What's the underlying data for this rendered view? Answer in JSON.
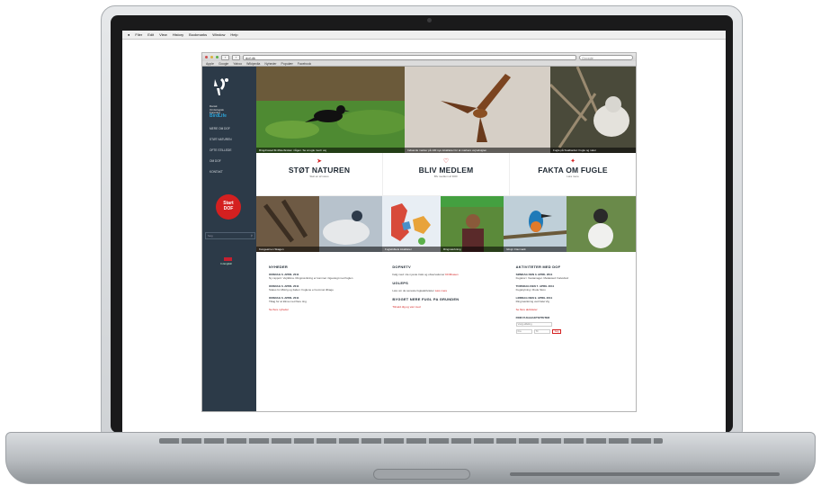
{
  "os_menu": [
    "Filer",
    "Edit",
    "View",
    "History",
    "Bookmarks",
    "Window",
    "Help"
  ],
  "browser": {
    "back": "‹",
    "forward": "›",
    "url": "dof.dk",
    "search_placeholder": "Google",
    "bookmarks": [
      "Apple",
      "Google",
      "Yahoo",
      "Wikipedia",
      "Nyheder",
      "Populær",
      "Facebook"
    ]
  },
  "sidebar": {
    "org_line1": "Dansk",
    "org_line2": "Ornitologisk",
    "org_line3": "Forening",
    "org_brand": "BirdLife",
    "nav": [
      "Mere om DOF",
      "Støt naturen",
      "Ofte stillede",
      "Om DOF",
      "Kontakt"
    ],
    "start_line1": "Start",
    "start_line2": "DOF",
    "search_placeholder": "Søg",
    "search_icon": "magnifier-icon",
    "lang_label": "In English"
  },
  "hero_captions": [
    "Ringdrossel fik Østerbrokan i tågen. Se at ugle med i vej",
    "Indsamle marker på 130 nye lokaliteter for at markere vejrudsigten",
    "Fugle på Svalbardet: Fugle og natur"
  ],
  "ctas": [
    {
      "icon": "bird-icon",
      "title": "STØT NATUREN",
      "sub": "Støt en af vores"
    },
    {
      "icon": "heart-icon",
      "title": "BLIV MEDLEM",
      "sub": "Blv medlem af DOF"
    },
    {
      "icon": "birds-icon",
      "title": "FAKTA OM FUGLE",
      "sub": "Læs mere"
    }
  ],
  "strip_captions": [
    "Kongeørnen Skagen",
    "Fuglefolkets lokaliteter",
    "Ringmærkning",
    "Isfugl i Danmark"
  ],
  "columns": {
    "news": {
      "title": "NYHEDER",
      "items": [
        {
          "date": "ONSDAG 6. APRIL 2011",
          "text": "Ny rapport: Vejrklima. Ringmærkning er kommet i ligevægt med fuglen"
        },
        {
          "date": "ONSDAG 6. APRIL 2011",
          "text": "Status for Østrig og Italien: Fuglene er kommet tilbage"
        },
        {
          "date": "ONSDAG 6. APRIL 2011",
          "text": "Tiltag for at klima med flere ting"
        }
      ],
      "more": "Se flere nyheder"
    },
    "middle": {
      "title1": "DOFNETV",
      "text1": "Følg med i de nyeste træk og observationer",
      "link1": "DOFbasen",
      "title2": "UGLEPS",
      "text2": "Læs om de seneste fugleaktiviteter",
      "link2": "Læs mere",
      "title3": "BYGGET NERE FUGL PA GRUNDEN",
      "link3": "Tilmeld dig og vær med"
    },
    "activities": {
      "title": "AKTIVITETER MED DOF",
      "items": [
        {
          "date": "SØNDAG DEN 3. APRIL 2011",
          "text": "Fugletur i Vestamager. Mødested: Kalvebod"
        },
        {
          "date": "TORSDAG DEN 7. APRIL 2011",
          "text": "Fuglelytning i Rude Skov"
        },
        {
          "date": "LØRDAG DEN 9. APRIL 2011",
          "text": "Ringmærkning ved Kalø Vig"
        }
      ],
      "more": "Se flere aktiviteter",
      "form_title": "FIND FUGLEAKTIVITETER",
      "form_select": "Vælg afdeling",
      "form_from": "Fra",
      "form_to": "Til",
      "form_button": "Søg"
    }
  }
}
